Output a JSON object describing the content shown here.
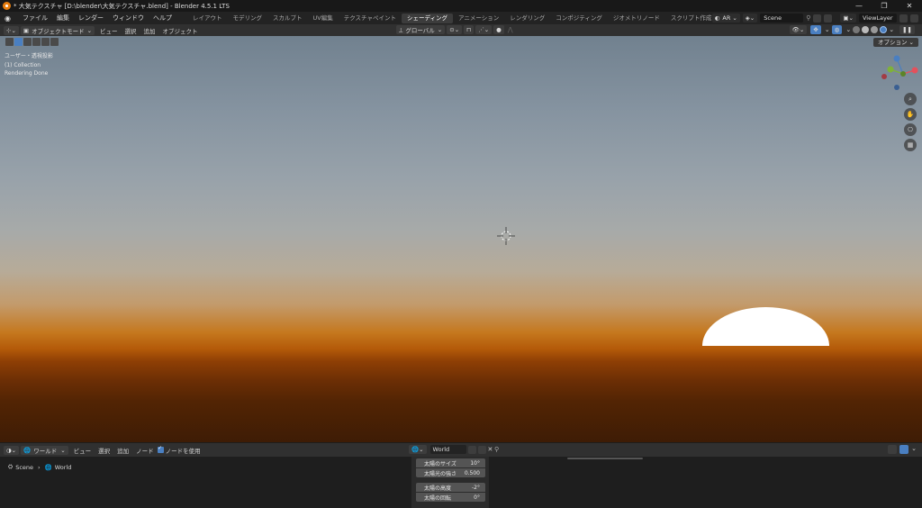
{
  "window": {
    "title": "* 大気テクスチャ [D:\\blender\\大気テクスチャ.blend] - Blender 4.5.1 LTS",
    "controls": [
      "—",
      "❐",
      "✕"
    ]
  },
  "menu": {
    "items": [
      "ファイル",
      "編集",
      "レンダー",
      "ウィンドウ",
      "ヘルプ"
    ],
    "workspaces": [
      "レイアウト",
      "モデリング",
      "スカルプト",
      "UV編集",
      "テクスチャペイント",
      "シェーディング",
      "アニメーション",
      "レンダリング",
      "コンポジティング",
      "ジオメトリノード",
      "スクリプト作成"
    ],
    "active_workspace_index": 5,
    "add_tab": "+",
    "ar_label": "AR",
    "scene": "Scene",
    "view_layer": "ViewLayer"
  },
  "view3d_header": {
    "mode": "オブジェクトモード",
    "menus": [
      "ビュー",
      "選択",
      "追加",
      "オブジェクト"
    ],
    "transform_orientation": "グローバル",
    "options": "オプション"
  },
  "viewport": {
    "overlay_lines": [
      "ユーザー・透視投影",
      "(1) Collection",
      "Rendering Done"
    ],
    "gizmo_axes": [
      "X",
      "Y",
      "Z"
    ]
  },
  "node_header": {
    "editor_type": "ワールド",
    "menus": [
      "ビュー",
      "選択",
      "追加",
      "ノード"
    ],
    "use_nodes_label": "ノードを使用",
    "use_nodes_checked": true,
    "world_name": "World"
  },
  "breadcrumb": {
    "scene": "Scene",
    "world": "World"
  },
  "properties": [
    {
      "label": "太陽のサイズ",
      "value": "10°"
    },
    {
      "label": "太陽光の強さ",
      "value": "0.500"
    },
    {
      "label": "太陽の高度",
      "value": "-2°"
    },
    {
      "label": "太陽の回転",
      "value": "0°"
    }
  ],
  "colors": {
    "accent": "#4a7fc1",
    "blender_orange": "#e87d0d",
    "gizmo_x": "#e4515c",
    "gizmo_y": "#7fb238",
    "gizmo_z": "#4a7fc1"
  }
}
